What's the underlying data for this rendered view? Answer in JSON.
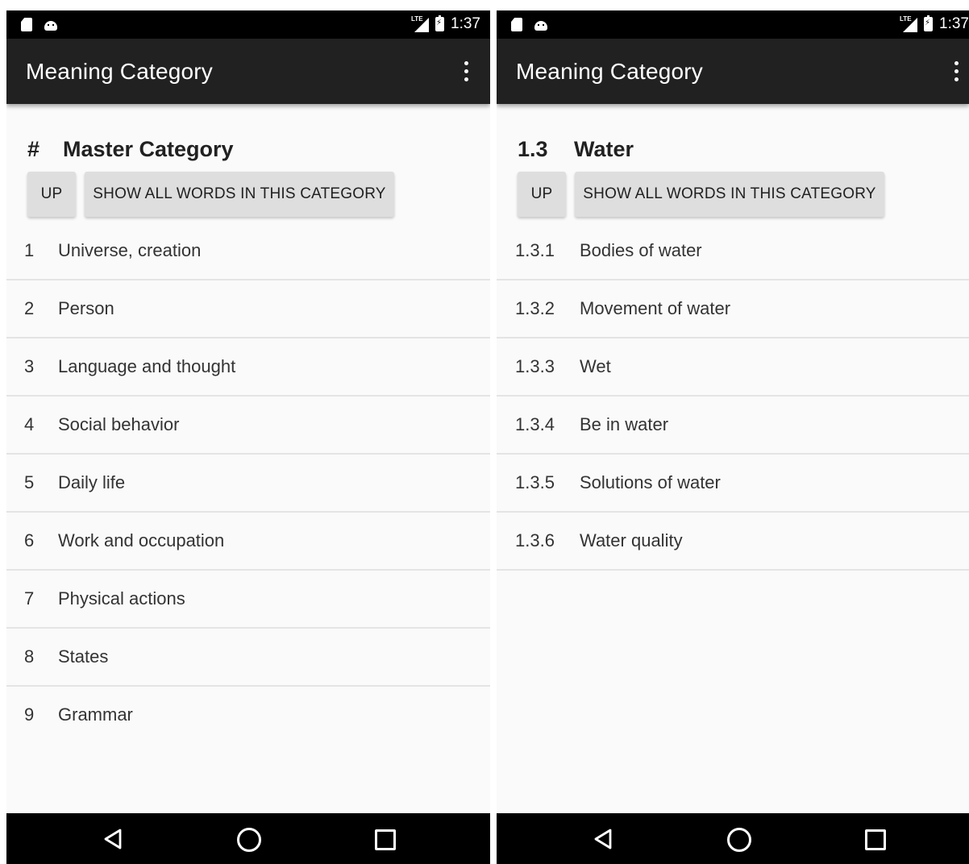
{
  "screens": [
    {
      "status_bar": {
        "time": "1:37",
        "network": "LTE"
      },
      "app_bar": {
        "title": "Meaning Category"
      },
      "category": {
        "number": "#",
        "name": "Master Category"
      },
      "buttons": {
        "up_label": "UP",
        "show_all_label": "SHOW ALL WORDS IN THIS CATEGORY"
      },
      "items": [
        {
          "num": "1",
          "label": "Universe, creation"
        },
        {
          "num": "2",
          "label": "Person"
        },
        {
          "num": "3",
          "label": "Language and thought"
        },
        {
          "num": "4",
          "label": "Social behavior"
        },
        {
          "num": "5",
          "label": "Daily life"
        },
        {
          "num": "6",
          "label": "Work and occupation"
        },
        {
          "num": "7",
          "label": "Physical actions"
        },
        {
          "num": "8",
          "label": "States"
        },
        {
          "num": "9",
          "label": "Grammar"
        }
      ]
    },
    {
      "status_bar": {
        "time": "1:37",
        "network": "LTE"
      },
      "app_bar": {
        "title": "Meaning Category"
      },
      "category": {
        "number": "1.3",
        "name": "Water"
      },
      "buttons": {
        "up_label": "UP",
        "show_all_label": "SHOW ALL WORDS IN THIS CATEGORY"
      },
      "items": [
        {
          "num": "1.3.1",
          "label": "Bodies of water"
        },
        {
          "num": "1.3.2",
          "label": "Movement of water"
        },
        {
          "num": "1.3.3",
          "label": "Wet"
        },
        {
          "num": "1.3.4",
          "label": "Be in water"
        },
        {
          "num": "1.3.5",
          "label": "Solutions of water"
        },
        {
          "num": "1.3.6",
          "label": "Water quality"
        }
      ]
    }
  ],
  "icons": {
    "status_left": [
      "sd-card-icon",
      "android-icon"
    ],
    "status_right": [
      "signal-icon",
      "battery-charging-icon"
    ],
    "app_bar": "overflow-menu-icon",
    "nav": [
      "back-icon",
      "home-icon",
      "recents-icon"
    ]
  },
  "colors": {
    "status_bar": "#000000",
    "app_bar": "#212121",
    "background": "#fafafa",
    "button": "#dedede",
    "divider": "#e4e4e4",
    "nav_bar": "#000000"
  }
}
